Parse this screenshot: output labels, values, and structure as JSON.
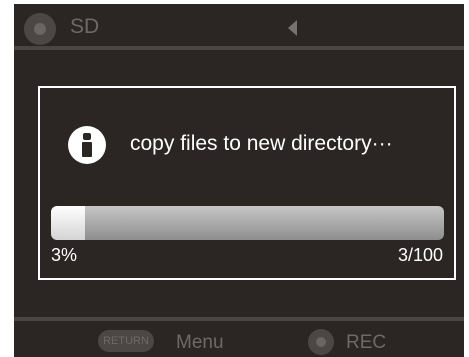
{
  "topbar": {
    "storage_label": "SD",
    "storage_icon": "sd-card-icon",
    "back_icon": "left-arrow-icon"
  },
  "dialog": {
    "icon": "info-icon",
    "message": "copy files to new directory···",
    "progress": {
      "fraction": 0.03,
      "percent_label": "3%",
      "count_label": "3/100"
    }
  },
  "bottombar": {
    "return_badge": "RETURN",
    "menu_label": "Menu",
    "rec_icon": "record-icon",
    "rec_label": "REC"
  },
  "colors": {
    "background": "#2b2624",
    "dimmed_text": "#6e6866",
    "dialog_border": "#ffffff"
  }
}
